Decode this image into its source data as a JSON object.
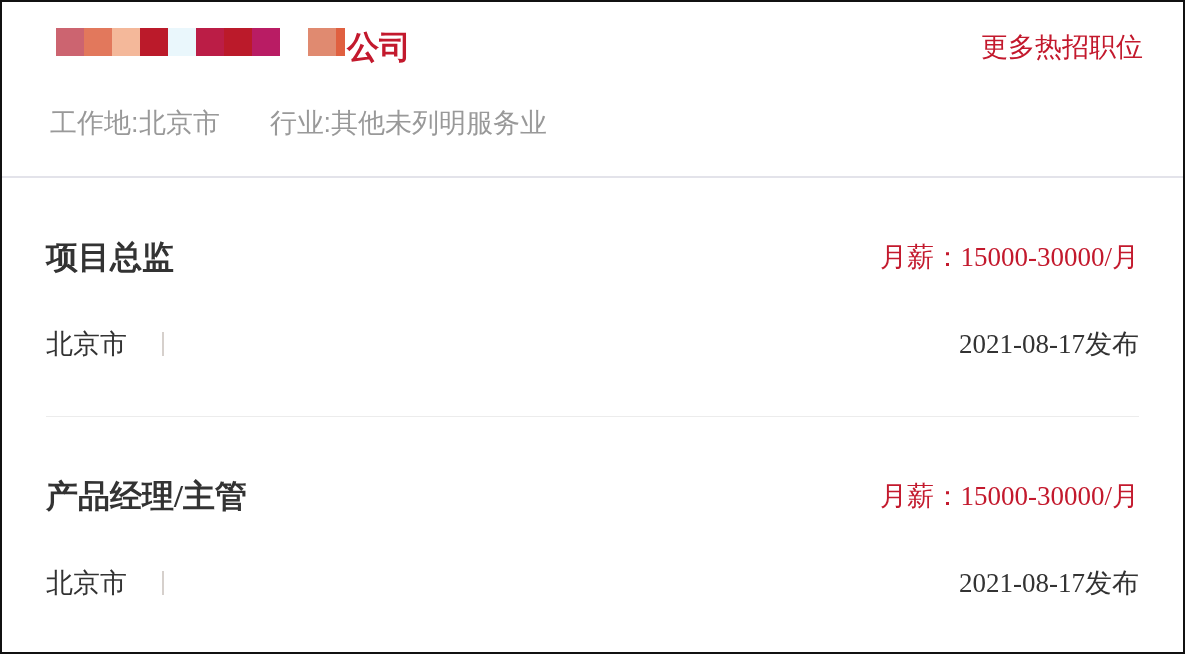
{
  "company": {
    "name": "公司",
    "location": "工作地:北京市",
    "industry": "行业:其他未列明服务业"
  },
  "more_link": "更多热招职位",
  "jobs": [
    {
      "title": "项目总监",
      "salary": "月薪：15000-30000/月",
      "location": "北京市",
      "posted": "2021-08-17发布"
    },
    {
      "title": "产品经理/主管",
      "salary": "月薪：15000-30000/月",
      "location": "北京市",
      "posted": "2021-08-17发布"
    }
  ]
}
